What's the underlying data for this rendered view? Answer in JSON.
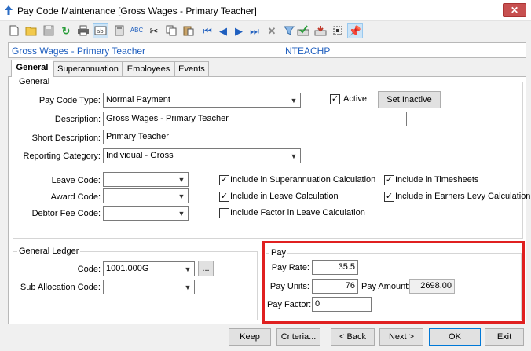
{
  "window": {
    "title": "Pay Code Maintenance  [Gross Wages - Primary Teacher]",
    "close_glyph": "✕"
  },
  "toolbar": {
    "icons": [
      "new-icon",
      "open-icon",
      "save-icon",
      "refresh-icon",
      "print-icon",
      "text-field-icon",
      "calculator-icon",
      "spellcheck-icon",
      "cut-icon",
      "copy-icon",
      "paste-icon",
      "first-record-icon",
      "previous-record-icon",
      "next-record-icon",
      "last-record-icon",
      "delete-icon",
      "filter-icon",
      "approve-icon",
      "export-icon",
      "select-icon",
      "pin-icon"
    ]
  },
  "header": {
    "name": "Gross Wages - Primary Teacher",
    "code": "NTEACHP"
  },
  "tabs": [
    {
      "label": "General"
    },
    {
      "label": "Superannuation"
    },
    {
      "label": "Employees"
    },
    {
      "label": "Events"
    }
  ],
  "general": {
    "group_title": "General",
    "pay_code_type_label": "Pay Code Type:",
    "pay_code_type_value": "Normal Payment",
    "active_label": "Active",
    "active_checked": true,
    "set_inactive_label": "Set Inactive",
    "description_label": "Description:",
    "description_value": "Gross Wages - Primary Teacher",
    "short_description_label": "Short Description:",
    "short_description_value": "Primary Teacher",
    "reporting_category_label": "Reporting Category:",
    "reporting_category_value": "Individual - Gross",
    "leave_code_label": "Leave Code:",
    "leave_code_value": "",
    "award_code_label": "Award Code:",
    "award_code_value": "",
    "debtor_fee_code_label": "Debtor Fee Code:",
    "debtor_fee_code_value": "",
    "checks": {
      "include_super": {
        "label": "Include in Superannuation Calculation",
        "checked": true
      },
      "include_leave": {
        "label": "Include in Leave Calculation",
        "checked": true
      },
      "include_factor": {
        "label": "Include Factor in Leave Calculation",
        "checked": false
      },
      "include_timesheets": {
        "label": "Include in Timesheets",
        "checked": true
      },
      "include_earners_levy": {
        "label": "Include in Earners Levy Calculation",
        "checked": true
      }
    }
  },
  "general_ledger": {
    "group_title": "General Ledger",
    "code_label": "Code:",
    "code_value": "1001.000G",
    "browse_label": "...",
    "sub_allocation_label": "Sub Allocation Code:",
    "sub_allocation_value": ""
  },
  "pay": {
    "group_title": "Pay",
    "pay_rate_label": "Pay Rate:",
    "pay_rate_value": "35.5",
    "pay_units_label": "Pay Units:",
    "pay_units_value": "76",
    "pay_amount_label": "Pay Amount:",
    "pay_amount_value": "2698.00",
    "pay_factor_label": "Pay Factor:",
    "pay_factor_value": "0"
  },
  "buttons": {
    "keep": "Keep",
    "criteria": "Criteria...",
    "back": "< Back",
    "next": "Next >",
    "ok": "OK",
    "exit": "Exit"
  },
  "colors": {
    "header_text": "#1f5fbf",
    "highlight_box": "#e02020"
  }
}
